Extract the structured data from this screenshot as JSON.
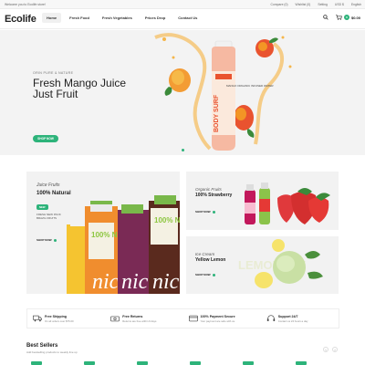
{
  "topbar": {
    "welcome": "Welcome you to Ecolife store!",
    "links": [
      "Compare (0)",
      "Wishlist (0)",
      "Setting",
      "USD $",
      "English"
    ]
  },
  "header": {
    "logo": "Ecolife",
    "nav": [
      "Home",
      "Fresh Food",
      "Fresh Vegetables",
      "Prices Drop",
      "Contact Us"
    ],
    "cart_count": "0",
    "cart_total": "$0.00"
  },
  "hero": {
    "subtitle": "ORIN PURE & NATURE",
    "title": "Fresh Mango Juice Just Fruit",
    "button": "SHOP NOW",
    "bottle_label": "BODY SURF",
    "bottle_text": "MANGO ORGANIC INFUSED WATER"
  },
  "promos": {
    "juice": {
      "subtitle": "Juice Fruits",
      "title": "100% Natural",
      "badge": "NEW",
      "desc": "FRESH NEW PACK BRAZIL FRUITS",
      "shop": "SHOP NOW",
      "bottle_text": "100% NATURAL",
      "bottle_script": "nic"
    },
    "strawberry": {
      "subtitle": "Organic Fruits",
      "title": "100% Strawberry",
      "shop": "SHOP NOW"
    },
    "icecream": {
      "subtitle": "Ice Cream",
      "title": "Yellow Lemon",
      "shop": "SHOP NOW",
      "watermark": "LEMONADE"
    }
  },
  "features": [
    {
      "icon": "truck-icon",
      "title": "Free Shipping",
      "desc": "On all orders over $75.00"
    },
    {
      "icon": "money-icon",
      "title": "Free Returns",
      "desc": "Returns are free within 9 days"
    },
    {
      "icon": "card-icon",
      "title": "100% Payment Secure",
      "desc": "Your payment are safe with us."
    },
    {
      "icon": "headset-icon",
      "title": "Support 24/7",
      "desc": "Contact us 24 hours a day"
    }
  ],
  "best_sellers": {
    "title": "Best Sellers",
    "subtitle": "Add bestselling products to weekly line up"
  },
  "colors": {
    "accent": "#2db37a",
    "mango": "#f5a623",
    "strawberry": "#e0393c"
  }
}
